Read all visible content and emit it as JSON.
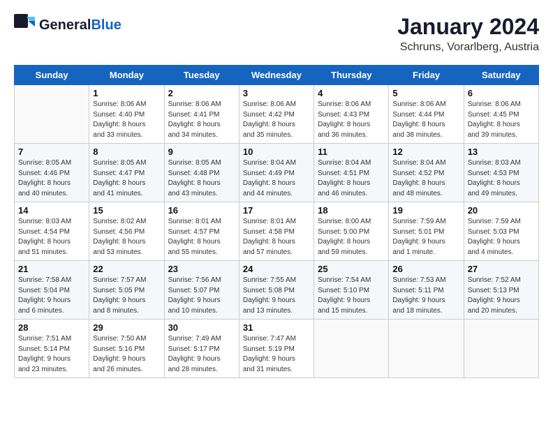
{
  "header": {
    "logo_general": "General",
    "logo_blue": "Blue",
    "title": "January 2024",
    "subtitle": "Schruns, Vorarlberg, Austria"
  },
  "weekdays": [
    "Sunday",
    "Monday",
    "Tuesday",
    "Wednesday",
    "Thursday",
    "Friday",
    "Saturday"
  ],
  "weeks": [
    [
      {
        "day": "",
        "info": ""
      },
      {
        "day": "1",
        "info": "Sunrise: 8:06 AM\nSunset: 4:40 PM\nDaylight: 8 hours\nand 33 minutes."
      },
      {
        "day": "2",
        "info": "Sunrise: 8:06 AM\nSunset: 4:41 PM\nDaylight: 8 hours\nand 34 minutes."
      },
      {
        "day": "3",
        "info": "Sunrise: 8:06 AM\nSunset: 4:42 PM\nDaylight: 8 hours\nand 35 minutes."
      },
      {
        "day": "4",
        "info": "Sunrise: 8:06 AM\nSunset: 4:43 PM\nDaylight: 8 hours\nand 36 minutes."
      },
      {
        "day": "5",
        "info": "Sunrise: 8:06 AM\nSunset: 4:44 PM\nDaylight: 8 hours\nand 38 minutes."
      },
      {
        "day": "6",
        "info": "Sunrise: 8:06 AM\nSunset: 4:45 PM\nDaylight: 8 hours\nand 39 minutes."
      }
    ],
    [
      {
        "day": "7",
        "info": "Sunrise: 8:05 AM\nSunset: 4:46 PM\nDaylight: 8 hours\nand 40 minutes."
      },
      {
        "day": "8",
        "info": "Sunrise: 8:05 AM\nSunset: 4:47 PM\nDaylight: 8 hours\nand 41 minutes."
      },
      {
        "day": "9",
        "info": "Sunrise: 8:05 AM\nSunset: 4:48 PM\nDaylight: 8 hours\nand 43 minutes."
      },
      {
        "day": "10",
        "info": "Sunrise: 8:04 AM\nSunset: 4:49 PM\nDaylight: 8 hours\nand 44 minutes."
      },
      {
        "day": "11",
        "info": "Sunrise: 8:04 AM\nSunset: 4:51 PM\nDaylight: 8 hours\nand 46 minutes."
      },
      {
        "day": "12",
        "info": "Sunrise: 8:04 AM\nSunset: 4:52 PM\nDaylight: 8 hours\nand 48 minutes."
      },
      {
        "day": "13",
        "info": "Sunrise: 8:03 AM\nSunset: 4:53 PM\nDaylight: 8 hours\nand 49 minutes."
      }
    ],
    [
      {
        "day": "14",
        "info": "Sunrise: 8:03 AM\nSunset: 4:54 PM\nDaylight: 8 hours\nand 51 minutes."
      },
      {
        "day": "15",
        "info": "Sunrise: 8:02 AM\nSunset: 4:56 PM\nDaylight: 8 hours\nand 53 minutes."
      },
      {
        "day": "16",
        "info": "Sunrise: 8:01 AM\nSunset: 4:57 PM\nDaylight: 8 hours\nand 55 minutes."
      },
      {
        "day": "17",
        "info": "Sunrise: 8:01 AM\nSunset: 4:58 PM\nDaylight: 8 hours\nand 57 minutes."
      },
      {
        "day": "18",
        "info": "Sunrise: 8:00 AM\nSunset: 5:00 PM\nDaylight: 8 hours\nand 59 minutes."
      },
      {
        "day": "19",
        "info": "Sunrise: 7:59 AM\nSunset: 5:01 PM\nDaylight: 9 hours\nand 1 minute."
      },
      {
        "day": "20",
        "info": "Sunrise: 7:59 AM\nSunset: 5:03 PM\nDaylight: 9 hours\nand 4 minutes."
      }
    ],
    [
      {
        "day": "21",
        "info": "Sunrise: 7:58 AM\nSunset: 5:04 PM\nDaylight: 9 hours\nand 6 minutes."
      },
      {
        "day": "22",
        "info": "Sunrise: 7:57 AM\nSunset: 5:05 PM\nDaylight: 9 hours\nand 8 minutes."
      },
      {
        "day": "23",
        "info": "Sunrise: 7:56 AM\nSunset: 5:07 PM\nDaylight: 9 hours\nand 10 minutes."
      },
      {
        "day": "24",
        "info": "Sunrise: 7:55 AM\nSunset: 5:08 PM\nDaylight: 9 hours\nand 13 minutes."
      },
      {
        "day": "25",
        "info": "Sunrise: 7:54 AM\nSunset: 5:10 PM\nDaylight: 9 hours\nand 15 minutes."
      },
      {
        "day": "26",
        "info": "Sunrise: 7:53 AM\nSunset: 5:11 PM\nDaylight: 9 hours\nand 18 minutes."
      },
      {
        "day": "27",
        "info": "Sunrise: 7:52 AM\nSunset: 5:13 PM\nDaylight: 9 hours\nand 20 minutes."
      }
    ],
    [
      {
        "day": "28",
        "info": "Sunrise: 7:51 AM\nSunset: 5:14 PM\nDaylight: 9 hours\nand 23 minutes."
      },
      {
        "day": "29",
        "info": "Sunrise: 7:50 AM\nSunset: 5:16 PM\nDaylight: 9 hours\nand 26 minutes."
      },
      {
        "day": "30",
        "info": "Sunrise: 7:49 AM\nSunset: 5:17 PM\nDaylight: 9 hours\nand 28 minutes."
      },
      {
        "day": "31",
        "info": "Sunrise: 7:47 AM\nSunset: 5:19 PM\nDaylight: 9 hours\nand 31 minutes."
      },
      {
        "day": "",
        "info": ""
      },
      {
        "day": "",
        "info": ""
      },
      {
        "day": "",
        "info": ""
      }
    ]
  ]
}
